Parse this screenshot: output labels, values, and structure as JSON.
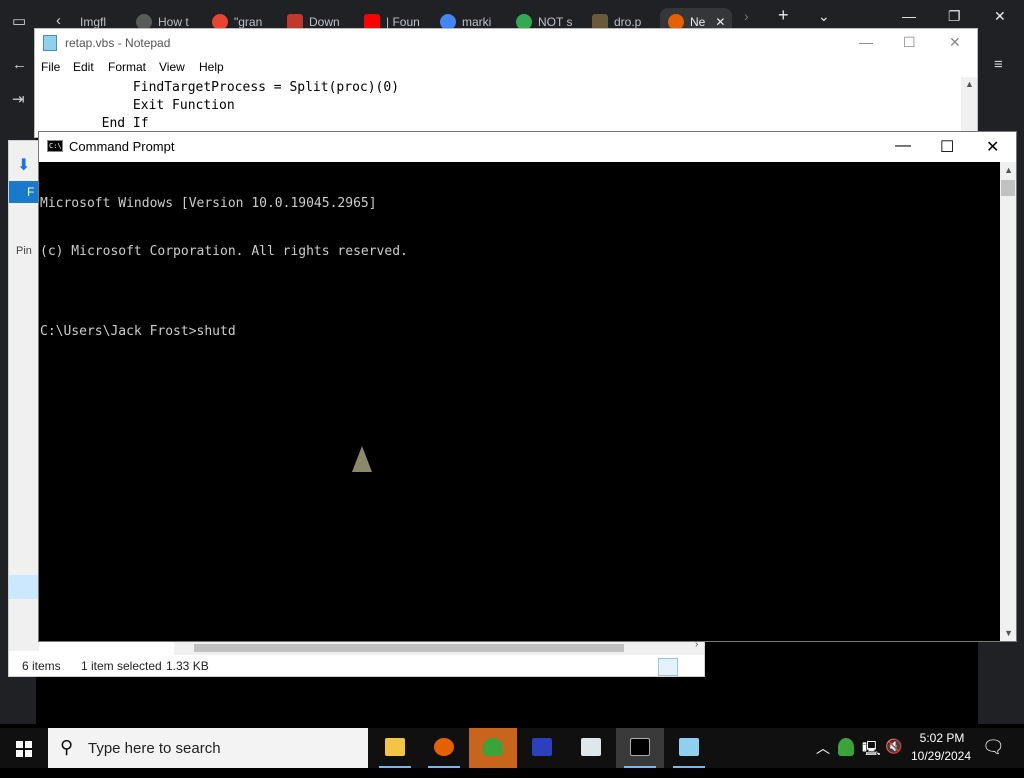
{
  "browser": {
    "tabs": [
      {
        "label": "Imgfl"
      },
      {
        "label": "How t"
      },
      {
        "label": "\"gran"
      },
      {
        "label": "Down"
      },
      {
        "label": "| Foun"
      },
      {
        "label": "marki"
      },
      {
        "label": "NOT s"
      },
      {
        "label": "dro.p"
      },
      {
        "label": "Ne"
      }
    ],
    "active_tab_index": 8
  },
  "explorer": {
    "file_tab": "F",
    "pin_label": "Pin",
    "status_items": "6 items",
    "status_selected": "1 item selected",
    "status_size": "1.33 KB"
  },
  "notepad": {
    "title": "retap.vbs - Notepad",
    "menu": [
      "File",
      "Edit",
      "Format",
      "View",
      "Help"
    ],
    "lines": [
      "            FindTargetProcess = Split(proc)(0)",
      "            Exit Function",
      "        End If"
    ]
  },
  "cmd": {
    "title": "Command Prompt",
    "lines": [
      "Microsoft Windows [Version 10.0.19045.2965]",
      "(c) Microsoft Corporation. All rights reserved.",
      "",
      "C:\\Users\\Jack Frost>shutd"
    ]
  },
  "taskbar": {
    "search_placeholder": "Type here to search",
    "clock_time": "5:02 PM",
    "clock_date": "10/29/2024"
  },
  "colors": {
    "accent": "#1979ca",
    "cmd_text": "#cccccc",
    "taskbar_highlight": "#c8641c"
  }
}
